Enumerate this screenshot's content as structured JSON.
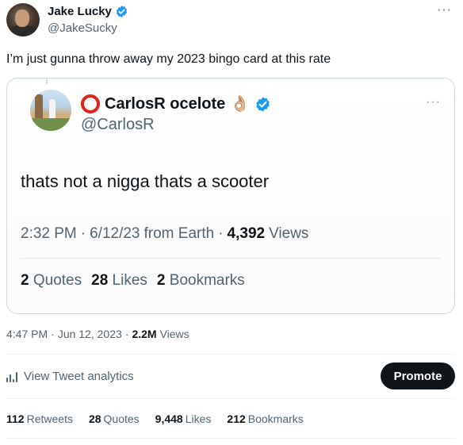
{
  "author": {
    "display_name": "Jake Lucky",
    "handle": "@JakeSucky",
    "verified_icon": "verified-badge-icon",
    "more_label": "···"
  },
  "tweet": {
    "text": "I’m just gunna throw away my 2023 bingo card at this rate",
    "time": "4:47 PM",
    "date": "Jun 12, 2023",
    "views_count": "2.2M",
    "views_label": "Views",
    "sep": "·"
  },
  "quote": {
    "display_name": "CarlosR ocelote",
    "emoji": "👌🏼",
    "handle": "@CarlosR",
    "more_label": "···",
    "text": "thats not a nigga thats a scooter",
    "time": "2:32 PM",
    "date": "6/12/23",
    "source": "from Earth",
    "views_count": "4,392",
    "views_label": "Views",
    "sep": "·",
    "quotes_count": "2",
    "quotes_label": "Quotes",
    "likes_count": "28",
    "likes_label": "Likes",
    "bookmarks_count": "2",
    "bookmarks_label": "Bookmarks"
  },
  "actions": {
    "analytics_label": "View Tweet analytics",
    "promote_label": "Promote"
  },
  "stats": {
    "retweets_count": "112",
    "retweets_label": "Retweets",
    "quotes_count": "28",
    "quotes_label": "Quotes",
    "likes_count": "9,448",
    "likes_label": "Likes",
    "bookmarks_count": "212",
    "bookmarks_label": "Bookmarks"
  },
  "colors": {
    "verified": "#1d9bf0",
    "ring": "#e0261b",
    "secondary_text": "#536471",
    "primary_text": "#0f1419"
  }
}
